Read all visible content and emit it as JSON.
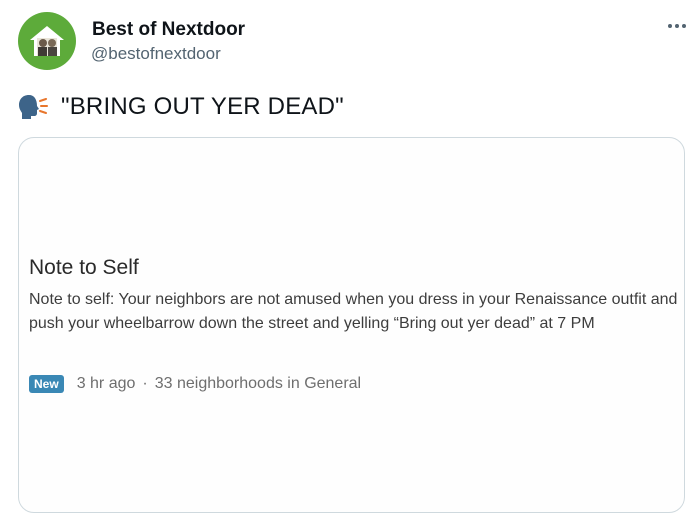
{
  "author": {
    "name": "Best of Nextdoor",
    "handle": "@bestofnextdoor",
    "avatar_icon": "house-logo-icon",
    "avatar_color": "#5dab3a"
  },
  "tweet": {
    "emoji_icon": "speaking-head-icon",
    "text": "\"BRING OUT YER DEAD\""
  },
  "more_menu_icon": "more-options-icon",
  "post": {
    "title": "Note to Self",
    "body": "Note to self:  Your neighbors are not amused when you dress in your Renaissance outfit and push your wheelbarrow down the street and yelling “Bring out yer dead” at 7 PM",
    "badge": "New",
    "time": "3 hr ago",
    "separator": "·",
    "where": "33 neighborhoods in General",
    "badge_color": "#3a88b5"
  }
}
